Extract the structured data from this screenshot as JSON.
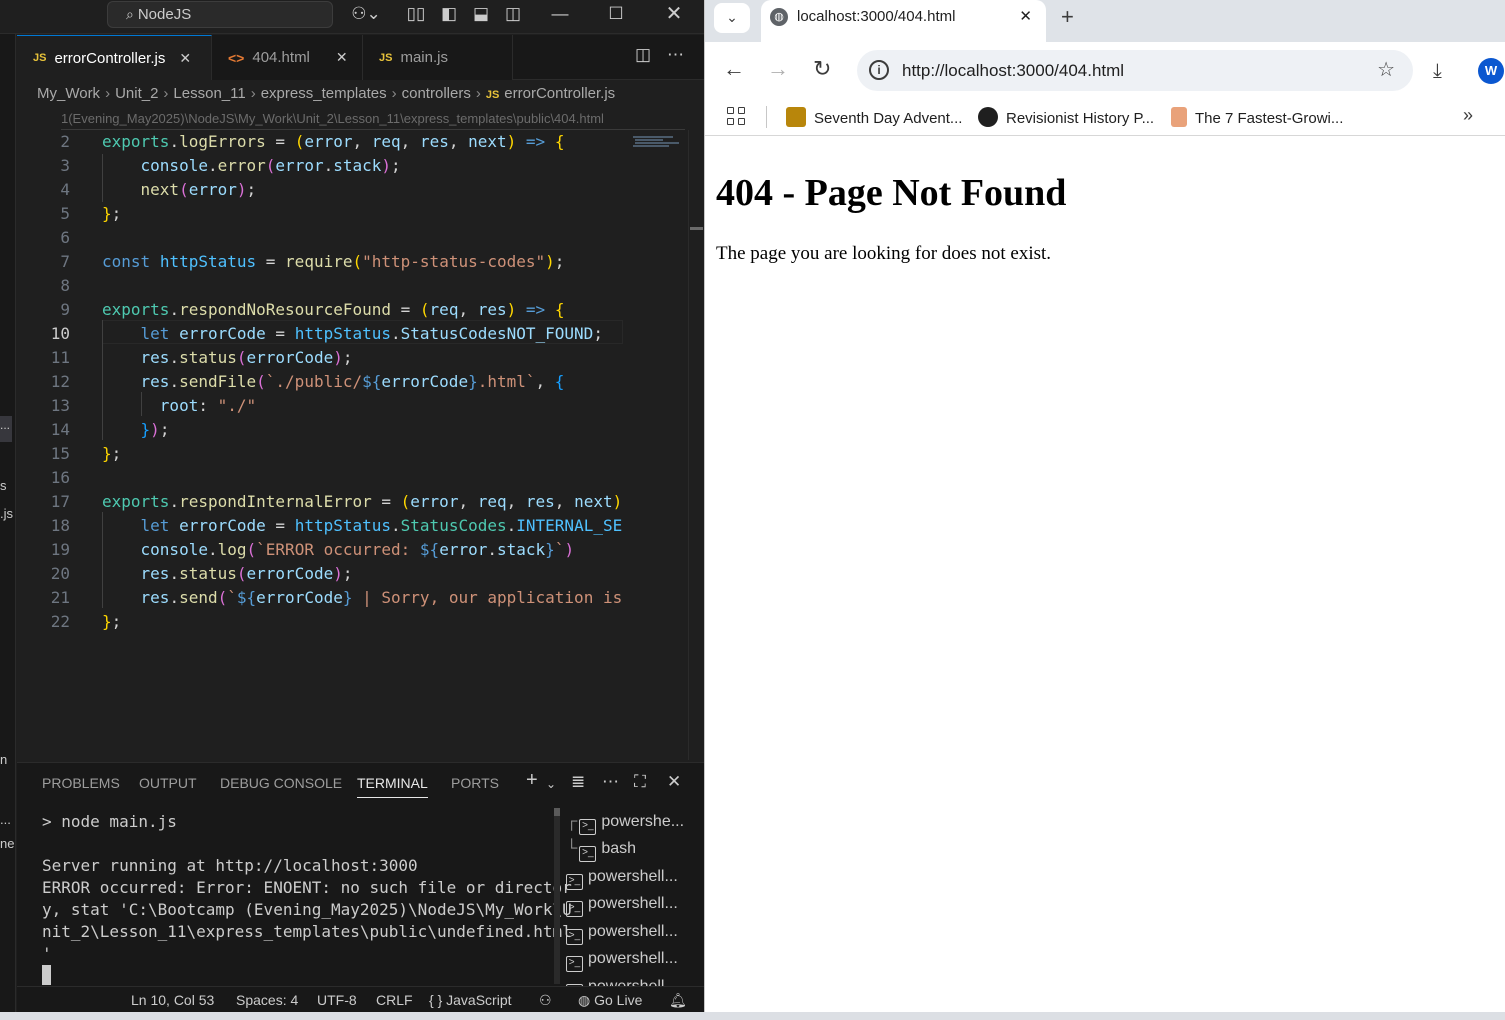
{
  "vscode": {
    "command_center": "NodeJS",
    "tabs": [
      {
        "label": "errorController.js",
        "kind": "JS"
      },
      {
        "label": "404.html",
        "kind": "<>"
      },
      {
        "label": "main.js",
        "kind": "JS"
      }
    ],
    "breadcrumb": [
      "My_Work",
      "Unit_2",
      "Lesson_11",
      "express_templates",
      "controllers",
      "errorController.js"
    ],
    "breadcrumb_ghost": "1(Evening_May2025)\\NodeJS\\My_Work\\Unit_2\\Lesson_11\\express_templates\\public\\404.html",
    "editor": {
      "line_numbers": [
        "2",
        "3",
        "4",
        "5",
        "6",
        "7",
        "8",
        "9",
        "10",
        "11",
        "12",
        "13",
        "14",
        "15",
        "16",
        "17",
        "18",
        "19",
        "20",
        "21",
        "22"
      ]
    },
    "panel": {
      "tabs": [
        "PROBLEMS",
        "OUTPUT",
        "DEBUG CONSOLE",
        "TERMINAL",
        "PORTS"
      ],
      "active_tab": "TERMINAL",
      "terminal_output": "> node main.js\n\nServer running at http://localhost:3000\nERROR occurred: Error: ENOENT: no such file or director\ny, stat 'C:\\Bootcamp (Evening_May2025)\\NodeJS\\My_Work\\U\nnit_2\\Lesson_11\\express_templates\\public\\undefined.html\n'",
      "terminals": [
        "powershe...",
        "bash",
        "powershell...",
        "powershell...",
        "powershell...",
        "powershell...",
        "powershell..."
      ]
    },
    "statusbar": {
      "position": "Ln 10, Col 53",
      "spaces": "Spaces: 4",
      "encoding": "UTF-8",
      "eol": "CRLF",
      "language": "{ } JavaScript",
      "golive": "Go Live"
    },
    "sidebar_fragments": [
      "s",
      ".js",
      "n",
      "...",
      "ne"
    ]
  },
  "chrome": {
    "tab_title": "localhost:3000/404.html",
    "url": "http://localhost:3000/404.html",
    "profile_initial": "W",
    "bookmarks": [
      "Seventh Day Advent...",
      "Revisionist History P...",
      "The 7 Fastest-Growi..."
    ],
    "page": {
      "heading": "404 - Page Not Found",
      "paragraph": "The page you are looking for does not exist."
    }
  }
}
